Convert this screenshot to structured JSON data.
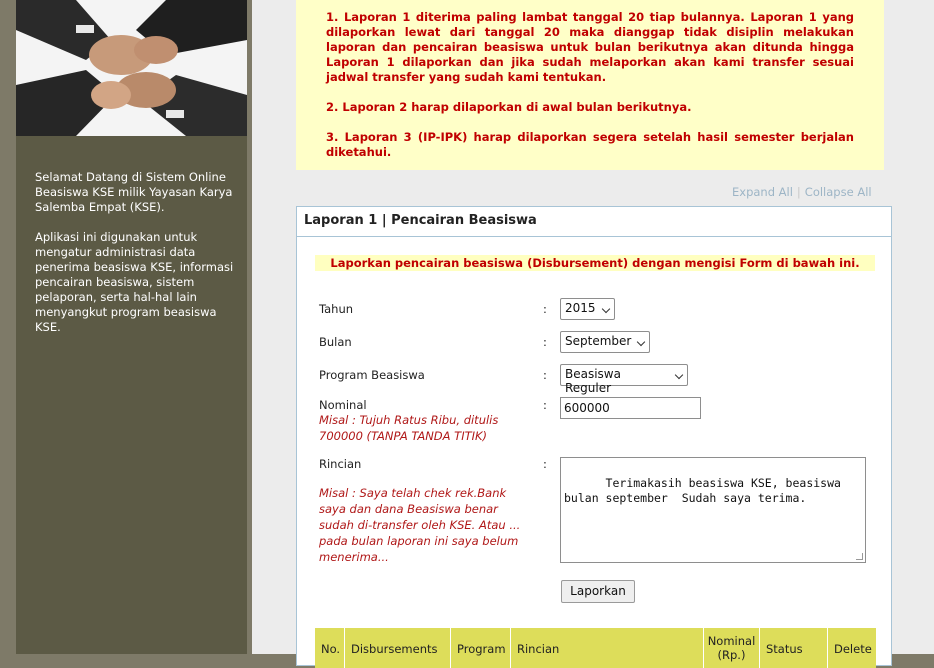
{
  "sidebar": {
    "welcome": "Selamat Datang di Sistem Online Beasiswa KSE milik Yayasan Karya Salemba Empat (KSE).",
    "description": "Aplikasi ini digunakan untuk mengatur administrasi data penerima beasiswa KSE, informasi pencairan beasiswa, sistem pelaporan, serta hal-hal lain menyangkut program beasiswa KSE."
  },
  "rules": [
    "1. Laporan 1 diterima paling lambat tanggal 20 tiap bulannya. Laporan 1 yang dilaporkan lewat dari tanggal 20 maka dianggap tidak disiplin melakukan laporan dan pencairan beasiswa untuk bulan berikutnya akan ditunda hingga Laporan 1 dilaporkan dan jika sudah melaporkan akan kami transfer sesuai jadwal transfer yang sudah kami tentukan.",
    "2. Laporan 2 harap dilaporkan di awal bulan berikutnya.",
    "3. Laporan 3 (IP-IPK) harap dilaporkan segera setelah hasil semester berjalan diketahui."
  ],
  "links": {
    "expand_all": "Expand All",
    "separator": "|",
    "collapse_all": "Collapse All"
  },
  "panel": {
    "title": "Laporan 1 | Pencairan Beasiswa",
    "notice": "Laporkan pencairan beasiswa (Disbursement) dengan mengisi Form di bawah ini."
  },
  "form": {
    "colon": ":",
    "tahun_label": "Tahun",
    "tahun_value": "2015",
    "bulan_label": "Bulan",
    "bulan_value": "September",
    "program_label": "Program Beasiswa",
    "program_value": "Beasiswa Reguler",
    "nominal_label": "Nominal",
    "nominal_hint": "Misal : Tujuh Ratus Ribu, ditulis 700000 (TANPA TANDA TITIK)",
    "nominal_value": "600000",
    "rincian_label": "Rincian",
    "rincian_hint": "Misal : Saya telah chek rek.Bank saya dan dana Beasiswa benar sudah di-transfer oleh KSE. Atau ... pada bulan laporan ini saya belum menerima...",
    "rincian_value": "Terimakasih beasiswa KSE, beasiswa\nbulan september  Sudah saya terima.",
    "submit_label": "Laporkan"
  },
  "table": {
    "headers": [
      "No.",
      "Disbursements",
      "Program",
      "Rincian",
      "Nominal (Rp.)",
      "Status",
      "Delete"
    ]
  },
  "colors": {
    "sidebar_bg": "#5c5a45",
    "notice_bg": "#ffffc8",
    "notice_text": "#c00000",
    "table_header_bg": "#dddd5a",
    "panel_border": "#a8c4d6"
  }
}
